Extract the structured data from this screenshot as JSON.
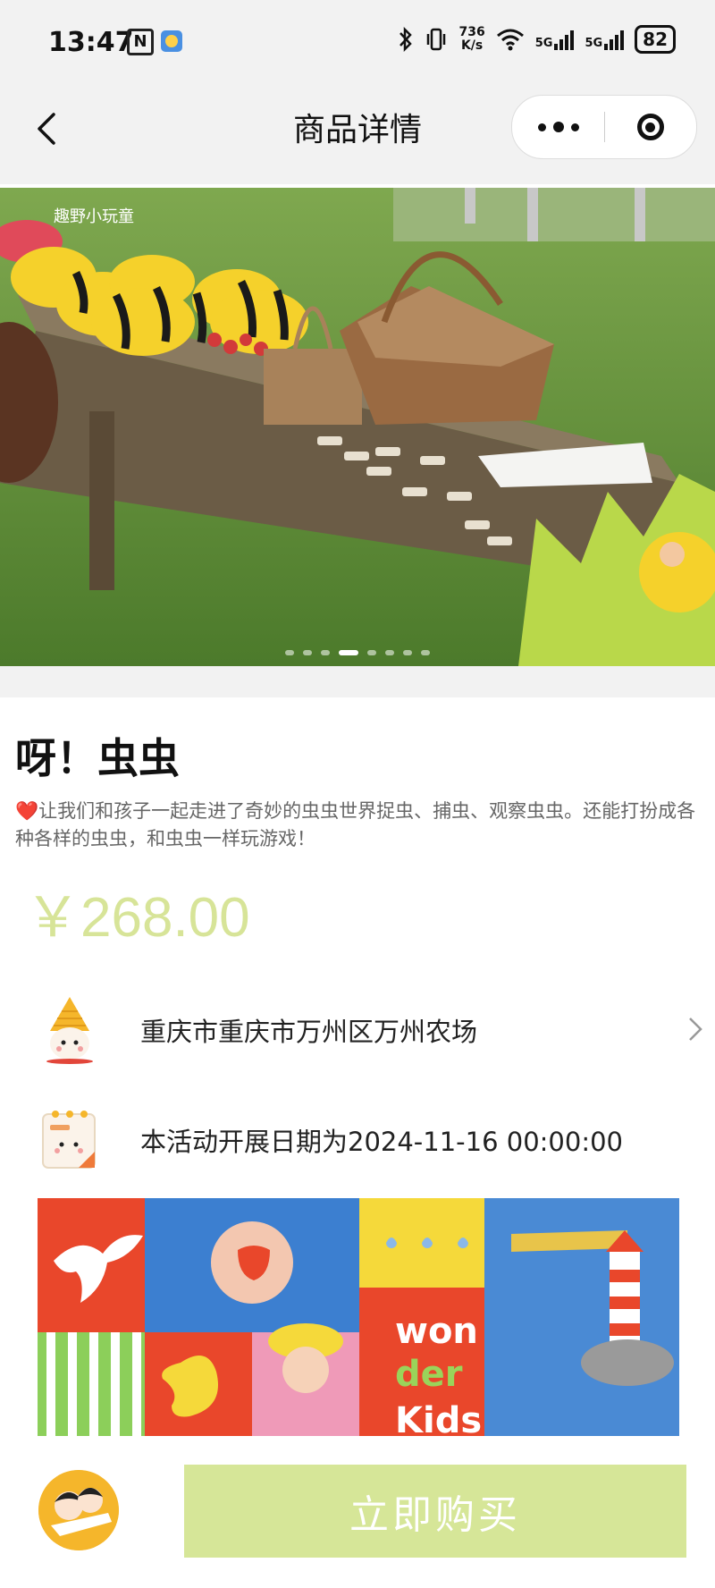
{
  "status_bar": {
    "time": "13:47",
    "n_badge": "N",
    "speed_value": "736",
    "speed_unit": "K/s",
    "network_1": "5G",
    "network_2": "5G",
    "battery": "82",
    "icons": [
      "nfc-icon",
      "weather-icon",
      "bluetooth-icon",
      "vibrate-icon",
      "wifi-icon",
      "signal-icon",
      "battery-icon"
    ]
  },
  "nav": {
    "title": "商品详情",
    "back_icon": "chevron-left-icon",
    "more_icon": "more-dots-icon",
    "close_icon": "target-icon"
  },
  "banner": {
    "image_count": 8,
    "active_index": 3,
    "watermark": "趣野小玩童"
  },
  "product": {
    "title": "呀！虫虫",
    "heart": "❤️",
    "description": "让我们和孩子一起走进了奇妙的虫虫世界捉虫、捕虫、观察虫虫。还能打扮成各种各样的虫虫，和虫虫一样玩游戏！",
    "price": "￥268.00"
  },
  "info_rows": {
    "location": "重庆市重庆市万州区万州农场",
    "date": "本活动开展日期为2024-11-16 00:00:00"
  },
  "poster": {
    "brand_line_1": "won",
    "brand_line_2": "der",
    "brand_line_3": "Kids"
  },
  "bottom_bar": {
    "buy_label": "立即购买"
  },
  "colors": {
    "price": "#d7e498",
    "buy_button": "#d6e698",
    "nav_background": "#f2f2f2"
  }
}
